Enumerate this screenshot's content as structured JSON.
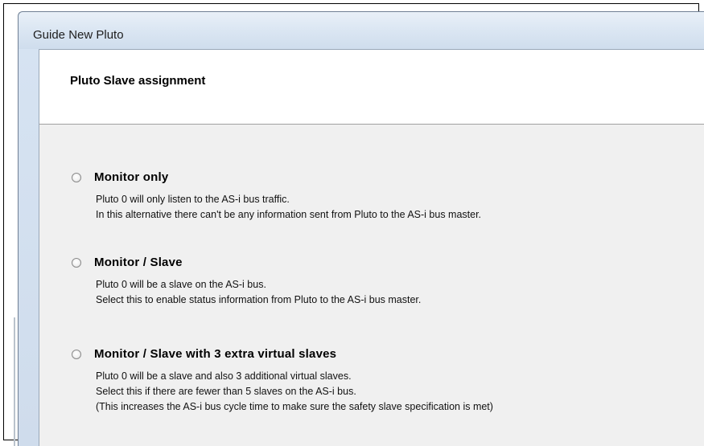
{
  "window": {
    "title": "Guide New Pluto"
  },
  "header": {
    "title": "Pluto Slave assignment"
  },
  "options": [
    {
      "label": "Monitor only",
      "selected": false,
      "description": [
        "Pluto 0 will only listen to the AS-i bus traffic.",
        "In this alternative there can't be any information sent from Pluto to the AS-i bus master."
      ]
    },
    {
      "label": "Monitor / Slave",
      "selected": false,
      "description": [
        "Pluto 0 will be a slave on the AS-i bus.",
        "Select this to enable status information from Pluto to the AS-i bus master."
      ]
    },
    {
      "label": "Monitor / Slave with 3 extra virtual slaves",
      "selected": false,
      "description": [
        "Pluto 0 will be a slave and also 3 additional virtual slaves.",
        "Select this if there are fewer than 5 slaves on the AS-i bus.",
        "(This increases the AS-i bus cycle time to make sure the safety slave specification is met)"
      ]
    }
  ]
}
